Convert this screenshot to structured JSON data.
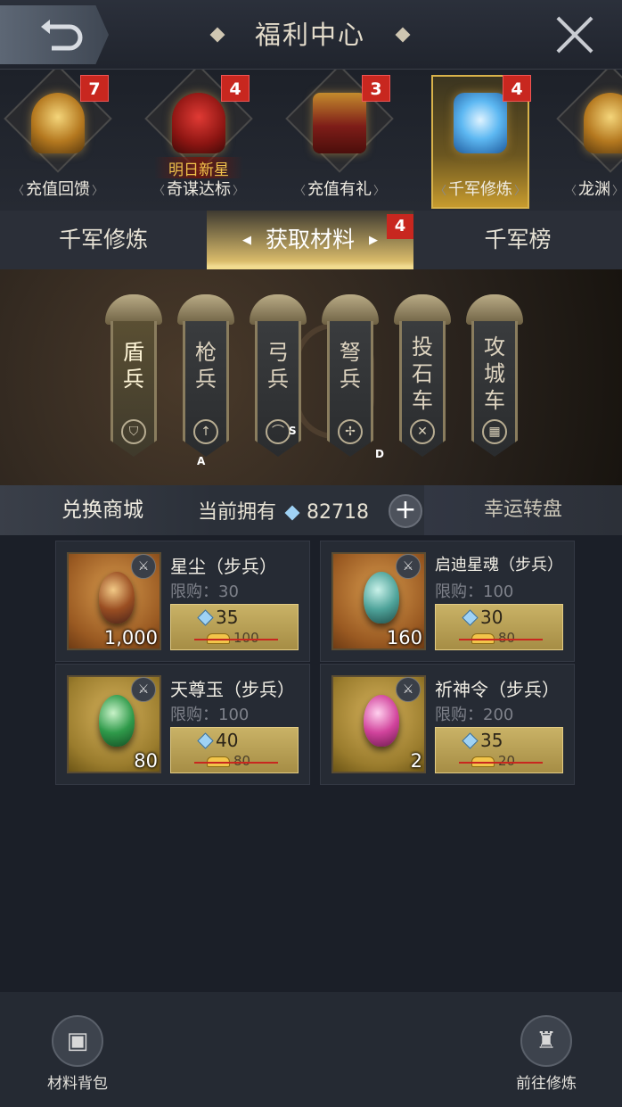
{
  "header": {
    "title": "福利中心",
    "back_icon": "back-arrow-icon",
    "close_icon": "close-icon"
  },
  "events": [
    {
      "label": "充值回馈",
      "badge": "7",
      "sub": ""
    },
    {
      "label": "奇谋达标",
      "badge": "4",
      "sub": "明日新星"
    },
    {
      "label": "充值有礼",
      "badge": "3",
      "sub": ""
    },
    {
      "label": "千军修炼",
      "badge": "4",
      "sub": "",
      "selected": true
    },
    {
      "label": "龙渊",
      "badge": "",
      "sub": ""
    }
  ],
  "tabs": [
    {
      "label": "千军修炼"
    },
    {
      "label": "获取材料",
      "selected": true,
      "badge": "4"
    },
    {
      "label": "千军榜"
    }
  ],
  "units": [
    {
      "name": "盾兵",
      "grade": "",
      "icon": "shield-icon",
      "selected": true
    },
    {
      "name": "枪兵",
      "grade": "A",
      "icon": "spear-icon"
    },
    {
      "name": "弓兵",
      "grade": "S",
      "icon": "bow-icon"
    },
    {
      "name": "弩兵",
      "grade": "D",
      "icon": "crossbow-icon"
    },
    {
      "name": "投石车",
      "grade": "",
      "icon": "catapult-icon"
    },
    {
      "name": "攻城车",
      "grade": "",
      "icon": "siege-ram-icon"
    }
  ],
  "subbar": {
    "left": "兑换商城",
    "owned_label": "当前拥有",
    "owned_value": "82718",
    "add": "+",
    "right": "幸运转盘"
  },
  "items": [
    {
      "name": "星尘（步兵）",
      "limit": "限购：30",
      "qty": "1,000",
      "price": "35",
      "old": "100"
    },
    {
      "name": "启迪星魂（步兵）",
      "limit": "限购：100",
      "qty": "160",
      "price": "30",
      "old": "80"
    },
    {
      "name": "天尊玉（步兵）",
      "limit": "限购：100",
      "qty": "80",
      "price": "40",
      "old": "80"
    },
    {
      "name": "祈神令（步兵）",
      "limit": "限购：200",
      "qty": "2",
      "price": "35",
      "old": "20"
    }
  ],
  "footer": {
    "left": "材料背包",
    "right": "前往修炼"
  },
  "colors": {
    "accent_gold": "#d9bb6a",
    "badge_red": "#c8271f",
    "background": "#1b1f28"
  }
}
